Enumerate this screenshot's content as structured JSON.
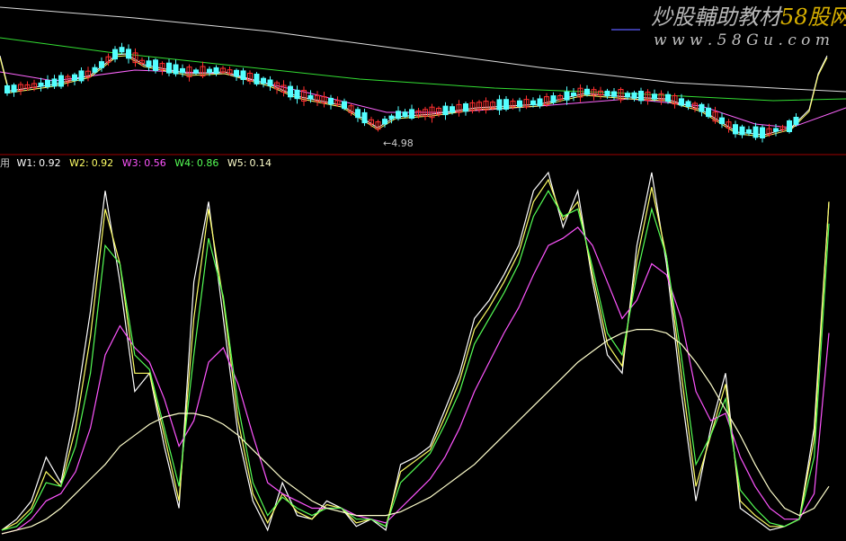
{
  "watermark": {
    "title_main": "炒股輔助教材",
    "title_brand": "58股网",
    "url": "w w w . 5 8 G u . c o m",
    "main_color": "#b8b8b8",
    "brand_color": "#d8b000"
  },
  "price_panel": {
    "low_marker": "←4.98",
    "ma_colors": [
      "#ffffff",
      "#ffff66",
      "#ff66ff",
      "#33dd33",
      "#dddddd"
    ],
    "up_color": "#ff3030",
    "down_color": "#54ffff"
  },
  "indicator_header": {
    "prefix": "用",
    "items": [
      {
        "label": "W1:",
        "value": "0.92",
        "color": "#ffffff"
      },
      {
        "label": "W2:",
        "value": "0.92",
        "color": "#ffff66"
      },
      {
        "label": "W3:",
        "value": "0.56",
        "color": "#ff55ff"
      },
      {
        "label": "W4:",
        "value": "0.86",
        "color": "#55ff55"
      },
      {
        "label": "W5:",
        "value": "0.14",
        "color": "#ffffcc"
      }
    ]
  },
  "chart_data": [
    {
      "type": "candlestick",
      "title": "",
      "x": [],
      "series": [],
      "annotations": [
        "←4.98"
      ]
    },
    {
      "type": "line",
      "title": "",
      "series_colors": [
        "#ffffff",
        "#ffff66",
        "#ff55ff",
        "#55ff55",
        "#ffffcc"
      ],
      "ylim": [
        0,
        1
      ],
      "series": [
        {
          "name": "W1",
          "last": 0.92,
          "values": [
            0.02,
            0.05,
            0.1,
            0.22,
            0.15,
            0.35,
            0.62,
            0.95,
            0.7,
            0.4,
            0.45,
            0.25,
            0.08,
            0.7,
            0.92,
            0.6,
            0.28,
            0.1,
            0.02,
            0.15,
            0.06,
            0.05,
            0.1,
            0.08,
            0.03,
            0.05,
            0.02,
            0.2,
            0.22,
            0.25,
            0.35,
            0.45,
            0.6,
            0.65,
            0.72,
            0.8,
            0.95,
            1.0,
            0.85,
            0.95,
            0.7,
            0.5,
            0.45,
            0.8,
            1.0,
            0.75,
            0.4,
            0.1,
            0.3,
            0.45,
            0.08,
            0.05,
            0.02,
            0.03,
            0.05,
            0.3,
            0.92
          ]
        },
        {
          "name": "W2",
          "last": 0.92,
          "values": [
            0.02,
            0.04,
            0.08,
            0.18,
            0.14,
            0.3,
            0.55,
            0.9,
            0.75,
            0.45,
            0.45,
            0.28,
            0.1,
            0.6,
            0.9,
            0.65,
            0.32,
            0.12,
            0.04,
            0.12,
            0.07,
            0.05,
            0.09,
            0.08,
            0.04,
            0.05,
            0.03,
            0.18,
            0.21,
            0.24,
            0.33,
            0.43,
            0.57,
            0.63,
            0.7,
            0.78,
            0.92,
            0.98,
            0.87,
            0.92,
            0.72,
            0.53,
            0.47,
            0.76,
            0.96,
            0.77,
            0.45,
            0.14,
            0.28,
            0.42,
            0.1,
            0.06,
            0.03,
            0.03,
            0.05,
            0.27,
            0.92
          ]
        },
        {
          "name": "W3",
          "last": 0.56,
          "values": [
            0.01,
            0.02,
            0.05,
            0.1,
            0.12,
            0.18,
            0.3,
            0.5,
            0.58,
            0.52,
            0.48,
            0.38,
            0.25,
            0.32,
            0.48,
            0.52,
            0.42,
            0.28,
            0.15,
            0.12,
            0.1,
            0.08,
            0.08,
            0.08,
            0.06,
            0.05,
            0.04,
            0.08,
            0.12,
            0.16,
            0.22,
            0.3,
            0.4,
            0.48,
            0.56,
            0.63,
            0.72,
            0.8,
            0.82,
            0.85,
            0.8,
            0.7,
            0.6,
            0.65,
            0.75,
            0.72,
            0.6,
            0.4,
            0.32,
            0.34,
            0.22,
            0.14,
            0.08,
            0.05,
            0.05,
            0.12,
            0.56
          ]
        },
        {
          "name": "W4",
          "last": 0.86,
          "values": [
            0.02,
            0.03,
            0.07,
            0.15,
            0.14,
            0.25,
            0.45,
            0.8,
            0.75,
            0.5,
            0.46,
            0.3,
            0.14,
            0.5,
            0.82,
            0.66,
            0.36,
            0.15,
            0.06,
            0.11,
            0.08,
            0.06,
            0.08,
            0.08,
            0.05,
            0.05,
            0.03,
            0.15,
            0.19,
            0.23,
            0.31,
            0.4,
            0.53,
            0.6,
            0.67,
            0.75,
            0.88,
            0.95,
            0.88,
            0.9,
            0.74,
            0.56,
            0.5,
            0.72,
            0.9,
            0.77,
            0.5,
            0.2,
            0.28,
            0.38,
            0.13,
            0.08,
            0.04,
            0.03,
            0.05,
            0.22,
            0.86
          ]
        },
        {
          "name": "W5",
          "last": 0.14,
          "values": [
            0.01,
            0.02,
            0.03,
            0.05,
            0.08,
            0.12,
            0.16,
            0.2,
            0.25,
            0.28,
            0.31,
            0.33,
            0.34,
            0.34,
            0.33,
            0.31,
            0.28,
            0.24,
            0.2,
            0.16,
            0.13,
            0.1,
            0.08,
            0.07,
            0.06,
            0.06,
            0.06,
            0.07,
            0.09,
            0.11,
            0.14,
            0.17,
            0.2,
            0.24,
            0.28,
            0.32,
            0.36,
            0.4,
            0.44,
            0.48,
            0.51,
            0.54,
            0.56,
            0.57,
            0.57,
            0.56,
            0.53,
            0.48,
            0.42,
            0.35,
            0.28,
            0.2,
            0.13,
            0.08,
            0.06,
            0.08,
            0.14
          ]
        }
      ]
    }
  ]
}
